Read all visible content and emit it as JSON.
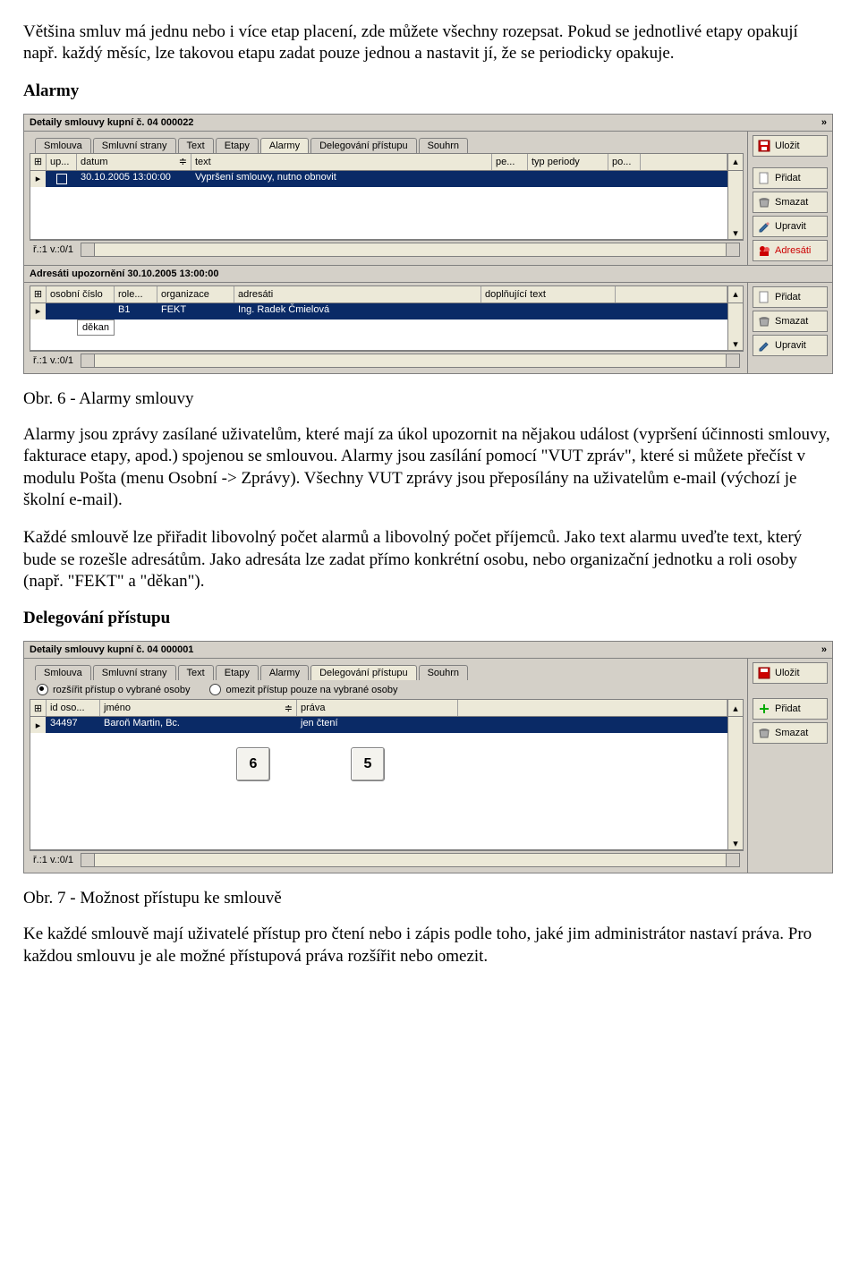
{
  "doc": {
    "p1": "Většina smluv má jednu nebo i více etap placení, zde můžete všechny rozepsat. Pokud se jednotlivé etapy opakují např. každý měsíc, lze takovou etapu zadat pouze jednou a nastavit jí, že se periodicky opakuje.",
    "h_alarmy": "Alarmy",
    "figcap6": "Obr. 6 - Alarmy smlouvy",
    "p2": "Alarmy jsou zprávy zasílané uživatelům, které mají za úkol upozornit na nějakou událost (vypršení účinnosti smlouvy, fakturace etapy, apod.) spojenou se smlouvou. Alarmy jsou zasílání pomocí \"VUT zpráv\", které si můžete přečíst v modulu Pošta (menu Osobní -> Zprávy). Všechny VUT zprávy jsou přeposílány na uživatelům e-mail (výchozí je školní e-mail).",
    "p3": "Každé smlouvě lze přiřadit libovolný počet alarmů a libovolný počet příjemců. Jako text alarmu uveďte text, který bude se rozešle adresátům. Jako adresáta lze zadat přímo konkrétní osobu, nebo organizační jednotku a roli osoby (např. \"FEKT\" a \"děkan\").",
    "h_deleg": "Delegování přístupu",
    "figcap7": "Obr. 7 - Možnost přístupu ke smlouvě",
    "p4": "Ke každé smlouvě mají uživatelé přístup pro čtení nebo i zápis podle toho, jaké jim administrátor nastaví práva. Pro každou smlouvu je ale možné přístupová práva rozšířit nebo omezit."
  },
  "app1": {
    "title": "Detaily smlouvy kupní č. 04 000022",
    "tabs": [
      "Smlouva",
      "Smluvní strany",
      "Text",
      "Etapy",
      "Alarmy",
      "Delegování přístupu",
      "Souhrn"
    ],
    "activeTab": 4,
    "grid1": {
      "cols": [
        "",
        "up...",
        "datum",
        "text",
        "pe...",
        "typ periody",
        "po..."
      ],
      "row": [
        "",
        "30.10.2005 13:00:00",
        "Vypršení smlouvy, nutno obnovit",
        "",
        "",
        ""
      ]
    },
    "status1": "ř.:1 v.:0/1",
    "btns1": [
      "Uložit",
      "Přidat",
      "Smazat",
      "Upravit",
      "Adresáti"
    ],
    "subheader": "Adresáti upozornění 30.10.2005 13:00:00",
    "grid2": {
      "cols": [
        "",
        "osobní číslo",
        "role...",
        "organizace",
        "adresáti",
        "doplňující text"
      ],
      "row": [
        "",
        "B1",
        "FEKT",
        "Ing. Radek Čmielová",
        ""
      ],
      "floating": "děkan"
    },
    "status2": "ř.:1 v.:0/1",
    "btns2": [
      "Přidat",
      "Smazat",
      "Upravit"
    ]
  },
  "app2": {
    "title": "Detaily smlouvy kupní č. 04 000001",
    "tabs": [
      "Smlouva",
      "Smluvní strany",
      "Text",
      "Etapy",
      "Alarmy",
      "Delegování přístupu",
      "Souhrn"
    ],
    "activeTab": 5,
    "radio1": "rozšířit přístup o vybrané osoby",
    "radio2": "omezit přístup pouze na vybrané osoby",
    "grid": {
      "cols": [
        "",
        "id oso...",
        "jméno",
        "práva"
      ],
      "row": [
        "34497",
        "Baroň Martin, Bc.",
        "jen čtení"
      ]
    },
    "btns": [
      "Uložit",
      "Přidat",
      "Smazat"
    ],
    "keys": [
      "6",
      "5"
    ],
    "status": "ř.:1 v.:0/1"
  },
  "icons": {
    "save": "save",
    "add": "add",
    "del": "del",
    "edit": "edit",
    "addr": "addr",
    "plus": "plus"
  }
}
